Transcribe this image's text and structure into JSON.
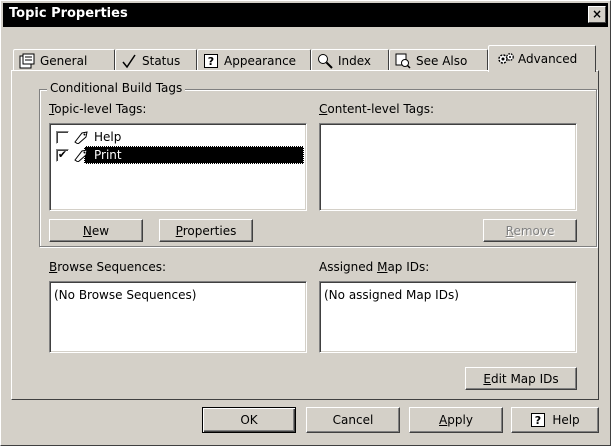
{
  "window": {
    "title": "Topic Properties",
    "close_glyph": "×"
  },
  "tabs": [
    {
      "label": "General",
      "icon": "general-tab-icon"
    },
    {
      "label": "Status",
      "icon": "checkmark-icon"
    },
    {
      "label": "Appearance",
      "icon": "question-box-icon"
    },
    {
      "label": "Index",
      "icon": "magnifier-icon"
    },
    {
      "label": "See Also",
      "icon": "see-also-icon"
    },
    {
      "label": "Advanced",
      "icon": "gears-icon",
      "active": true
    }
  ],
  "conditional_build_tags": {
    "group_title": "Conditional Build Tags",
    "topic_label_first": "T",
    "topic_label_rest": "opic-level Tags:",
    "content_label_first": "C",
    "content_label_rest": "ontent-level Tags:",
    "topic_tags": [
      {
        "name": "Help",
        "checked": false,
        "check_glyph": ""
      },
      {
        "name": "Print",
        "checked": true,
        "check_glyph": "✔",
        "selected": true
      }
    ],
    "new_first": "N",
    "new_rest": "ew",
    "properties_first": "P",
    "properties_rest": "roperties",
    "remove_first": "R",
    "remove_rest": "emove"
  },
  "browse_sequences": {
    "label_first": "B",
    "label_rest": "rowse Sequences:",
    "items": [
      "(No Browse Sequences)"
    ]
  },
  "map_ids": {
    "label_pre": "Assigned ",
    "label_first": "M",
    "label_rest": "ap IDs:",
    "items": [
      "(No assigned Map IDs)"
    ],
    "edit_first": "E",
    "edit_rest": "dit Map IDs"
  },
  "footer": {
    "ok": "OK",
    "cancel": "Cancel",
    "apply_first": "A",
    "apply_rest": "pply",
    "help": "Help"
  }
}
